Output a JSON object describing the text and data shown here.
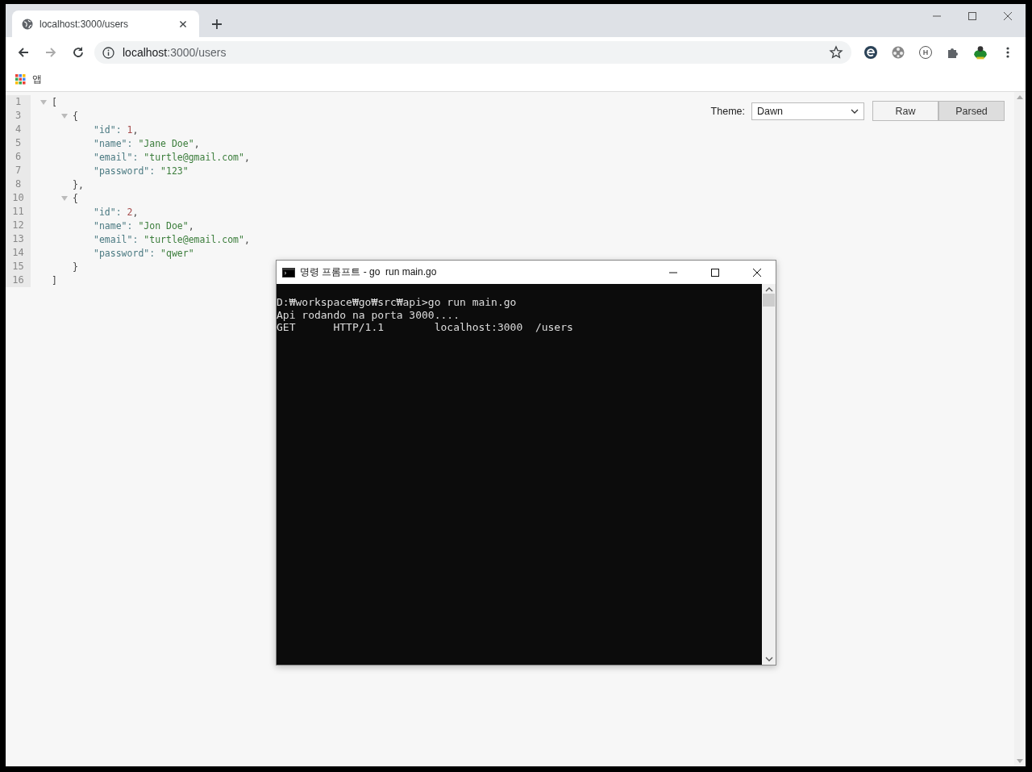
{
  "browser": {
    "tabs": [
      {
        "title": "localhost:3000/users",
        "selected": true
      }
    ],
    "address": {
      "host": "localhost",
      "rest": ":3000/users"
    },
    "bookmarks": [
      {
        "label": "앱"
      }
    ]
  },
  "viewer": {
    "theme_label": "Theme:",
    "theme": "Dawn",
    "modes": [
      {
        "label": "Raw",
        "selected": false
      },
      {
        "label": "Parsed",
        "selected": true
      }
    ],
    "lines": [
      {
        "number": "1",
        "text": "[",
        "expanded": true,
        "children": [
          {
            "number": "3",
            "text": "{",
            "expanded": true,
            "children": [
              {
                "number": "4",
                "key": "\"id\": ",
                "value": "1",
                "kind": "number",
                "tail": ","
              },
              {
                "number": "5",
                "key": "\"name\": ",
                "value": "\"Jane Doe\"",
                "kind": "string",
                "tail": ","
              },
              {
                "number": "6",
                "key": "\"email\": ",
                "value": "\"turtle@gmail.com\"",
                "kind": "string",
                "tail": ","
              },
              {
                "number": "7",
                "key": "\"password\": ",
                "value": "\"123\"",
                "kind": "string"
              }
            ]
          },
          {
            "number": "8",
            "text": "},"
          },
          {
            "number": "10",
            "text": "{",
            "expanded": true,
            "children": [
              {
                "number": "11",
                "key": "\"id\": ",
                "value": "2",
                "kind": "number",
                "tail": ","
              },
              {
                "number": "12",
                "key": "\"name\": ",
                "value": "\"Jon Doe\"",
                "kind": "string",
                "tail": ","
              },
              {
                "number": "13",
                "key": "\"email\": ",
                "value": "\"turtle@email.com\"",
                "kind": "string",
                "tail": ","
              },
              {
                "number": "14",
                "key": "\"password\": ",
                "value": "\"qwer\"",
                "kind": "string"
              }
            ]
          },
          {
            "number": "15",
            "text": "}"
          }
        ]
      },
      {
        "number": "16",
        "text": "]"
      }
    ]
  },
  "terminal": {
    "title": "명령 프롬프트 - go  run main.go",
    "lines": [
      "D:₩workspace₩go₩src₩api>go run main.go",
      "Api rodando na porta 3000....",
      "GET      HTTP/1.1        localhost:3000  /users"
    ]
  }
}
